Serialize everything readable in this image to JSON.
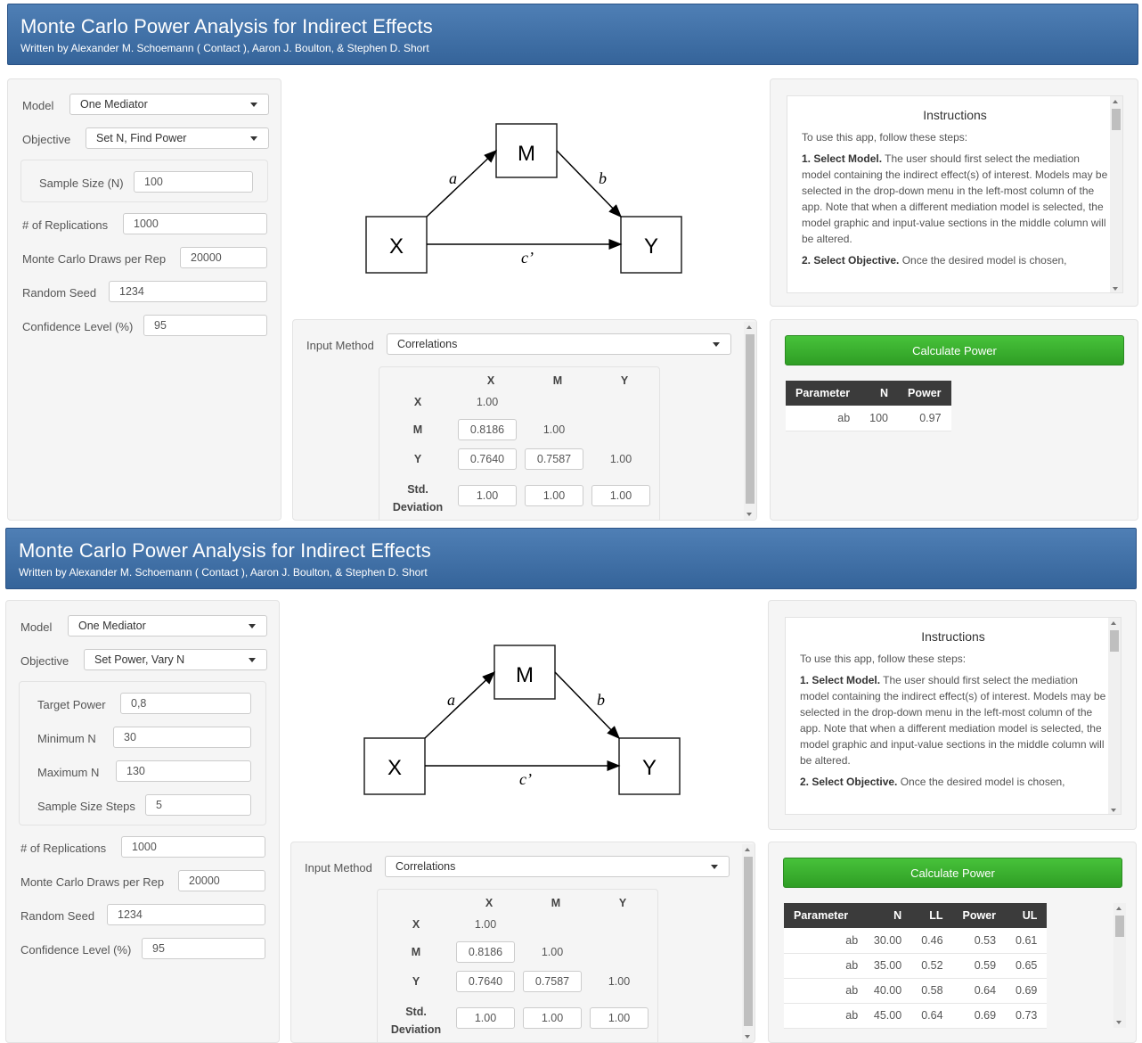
{
  "apps": [
    {
      "header": {
        "title": "Monte Carlo Power Analysis for Indirect Effects",
        "subtitle": "Written by Alexander M. Schoemann ( Contact ), Aaron J. Boulton, & Stephen D. Short"
      },
      "model": {
        "label": "Model",
        "value": "One Mediator"
      },
      "objective": {
        "label": "Objective",
        "value": "Set N, Find Power"
      },
      "inner_fields": [
        {
          "label": "Sample Size (N)",
          "value": "100"
        }
      ],
      "fields": [
        {
          "label": "# of Replications",
          "value": "1000"
        },
        {
          "label": "Monte Carlo Draws per Rep",
          "value": "20000"
        },
        {
          "label": "Random Seed",
          "value": "1234"
        },
        {
          "label": "Confidence Level (%)",
          "value": "95"
        }
      ],
      "diagram": {
        "x": "X",
        "m": "M",
        "y": "Y",
        "a": "a",
        "b": "b",
        "c": "c’"
      },
      "input_method": {
        "label": "Input Method",
        "value": "Correlations"
      },
      "matrix": {
        "cols": [
          "X",
          "M",
          "Y"
        ],
        "rows": [
          "X",
          "M",
          "Y"
        ],
        "xx": "1.00",
        "mx": "0.8186",
        "mm": "1.00",
        "yx": "0.7640",
        "ym": "0.7587",
        "yy": "1.00",
        "sd_label1": "Std.",
        "sd_label2": "Deviation",
        "sd": [
          "1.00",
          "1.00",
          "1.00"
        ]
      },
      "instructions": {
        "title": "Instructions",
        "intro": "To use this app, follow these steps:",
        "step1_bold": "1. Select Model.",
        "step1_text": " The user should first select the mediation model containing the indirect effect(s) of interest. Models may be selected in the drop-down menu in the left-most column of the app. Note that when a different mediation model is selected, the model graphic and input-value sections in the middle column will be altered.",
        "step2_bold": "2. Select Objective.",
        "step2_text": " Once the desired model is chosen,"
      },
      "calculate_label": "Calculate Power",
      "results": {
        "headers": [
          "Parameter",
          "N",
          "Power"
        ],
        "rows": [
          [
            "ab",
            "100",
            "0.97"
          ]
        ]
      }
    },
    {
      "header": {
        "title": "Monte Carlo Power Analysis for Indirect Effects",
        "subtitle": "Written by Alexander M. Schoemann ( Contact ), Aaron J. Boulton, & Stephen D. Short"
      },
      "model": {
        "label": "Model",
        "value": "One Mediator"
      },
      "objective": {
        "label": "Objective",
        "value": "Set Power, Vary N"
      },
      "inner_fields": [
        {
          "label": "Target Power",
          "value": "0,8"
        },
        {
          "label": "Minimum N",
          "value": "30"
        },
        {
          "label": "Maximum N",
          "value": "130"
        },
        {
          "label": "Sample Size Steps",
          "value": "5"
        }
      ],
      "fields": [
        {
          "label": "# of Replications",
          "value": "1000"
        },
        {
          "label": "Monte Carlo Draws per Rep",
          "value": "20000"
        },
        {
          "label": "Random Seed",
          "value": "1234"
        },
        {
          "label": "Confidence Level (%)",
          "value": "95"
        }
      ],
      "diagram": {
        "x": "X",
        "m": "M",
        "y": "Y",
        "a": "a",
        "b": "b",
        "c": "c’"
      },
      "input_method": {
        "label": "Input Method",
        "value": "Correlations"
      },
      "matrix": {
        "cols": [
          "X",
          "M",
          "Y"
        ],
        "rows": [
          "X",
          "M",
          "Y"
        ],
        "xx": "1.00",
        "mx": "0.8186",
        "mm": "1.00",
        "yx": "0.7640",
        "ym": "0.7587",
        "yy": "1.00",
        "sd_label1": "Std.",
        "sd_label2": "Deviation",
        "sd": [
          "1.00",
          "1.00",
          "1.00"
        ]
      },
      "instructions": {
        "title": "Instructions",
        "intro": "To use this app, follow these steps:",
        "step1_bold": "1. Select Model.",
        "step1_text": " The user should first select the mediation model containing the indirect effect(s) of interest. Models may be selected in the drop-down menu in the left-most column of the app. Note that when a different mediation model is selected, the model graphic and input-value sections in the middle column will be altered.",
        "step2_bold": "2. Select Objective.",
        "step2_text": " Once the desired model is chosen,"
      },
      "calculate_label": "Calculate Power",
      "results": {
        "headers": [
          "Parameter",
          "N",
          "LL",
          "Power",
          "UL"
        ],
        "rows": [
          [
            "ab",
            "30.00",
            "0.46",
            "0.53",
            "0.61"
          ],
          [
            "ab",
            "35.00",
            "0.52",
            "0.59",
            "0.65"
          ],
          [
            "ab",
            "40.00",
            "0.58",
            "0.64",
            "0.69"
          ],
          [
            "ab",
            "45.00",
            "0.64",
            "0.69",
            "0.73"
          ]
        ]
      }
    }
  ]
}
